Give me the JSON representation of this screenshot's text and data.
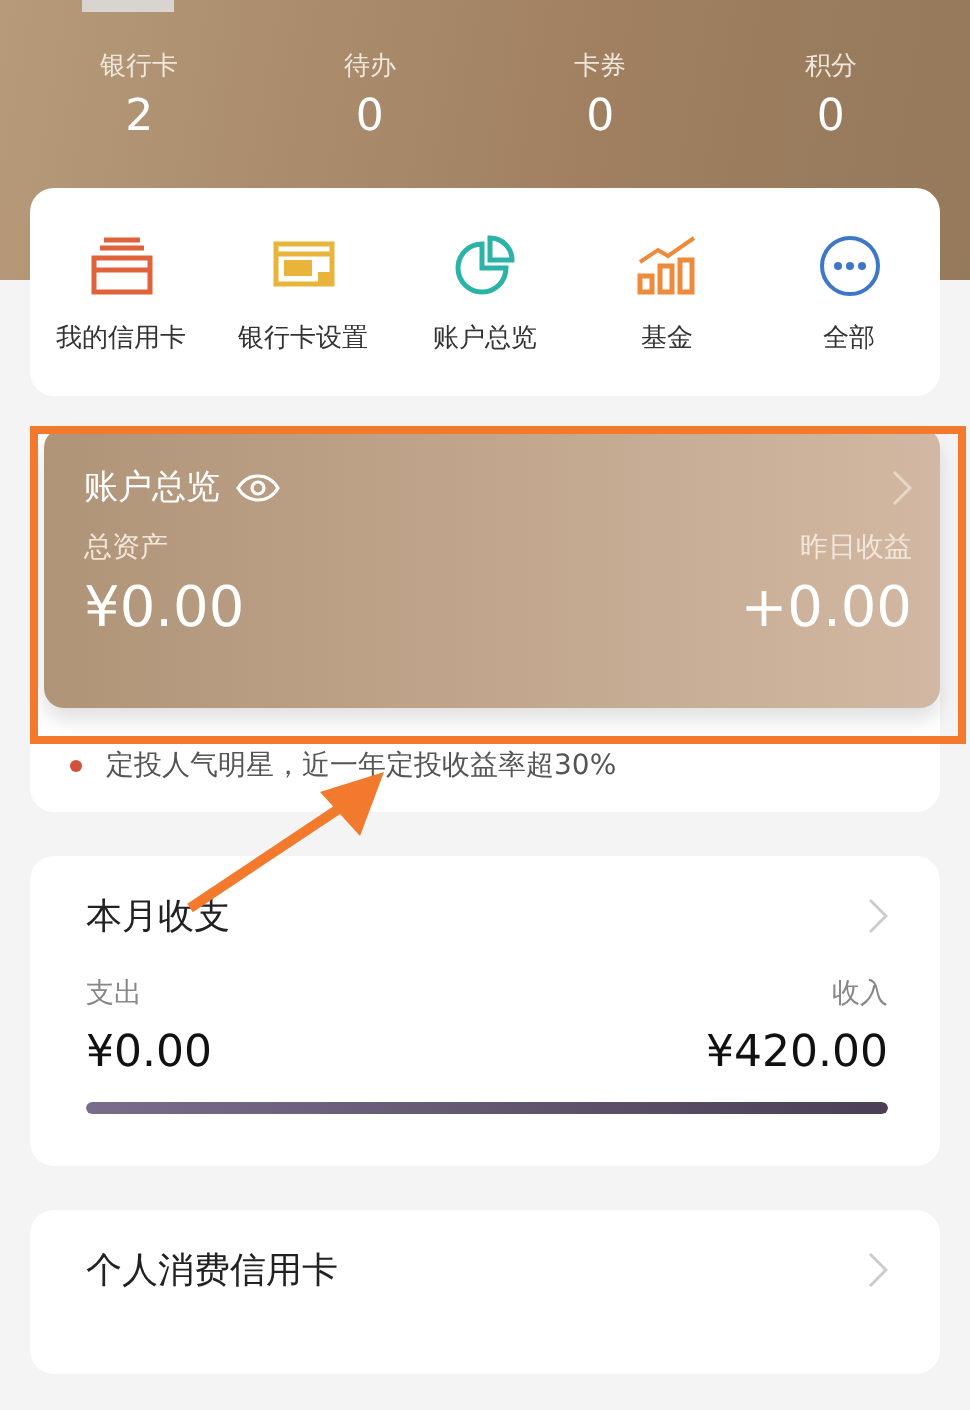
{
  "stats": [
    {
      "label": "银行卡",
      "value": "2"
    },
    {
      "label": "待办",
      "value": "0"
    },
    {
      "label": "卡券",
      "value": "0"
    },
    {
      "label": "积分",
      "value": "0"
    }
  ],
  "shortcuts": [
    {
      "label": "我的信用卡",
      "kind": "cards",
      "color": "#e0623a"
    },
    {
      "label": "银行卡设置",
      "kind": "pay",
      "color": "#e8b53a"
    },
    {
      "label": "账户总览",
      "kind": "pie",
      "color": "#2bb3a8"
    },
    {
      "label": "基金",
      "kind": "chart",
      "color": "#ee8a3a"
    },
    {
      "label": "全部",
      "kind": "more",
      "color": "#3f77c7"
    }
  ],
  "account": {
    "title": "账户总览",
    "left_label": "总资产",
    "left_value": "¥0.00",
    "right_label": "昨日收益",
    "right_value": "+0.00",
    "tip": "定投人气明星，近一年定投收益率超30%"
  },
  "monthly": {
    "title": "本月收支",
    "left_label": "支出",
    "left_value": "¥0.00",
    "right_label": "收入",
    "right_value": "¥420.00",
    "level": 1
  },
  "credit": {
    "title": "个人消费信用卡"
  },
  "annotation": {
    "highlight": true,
    "arrow": true
  }
}
